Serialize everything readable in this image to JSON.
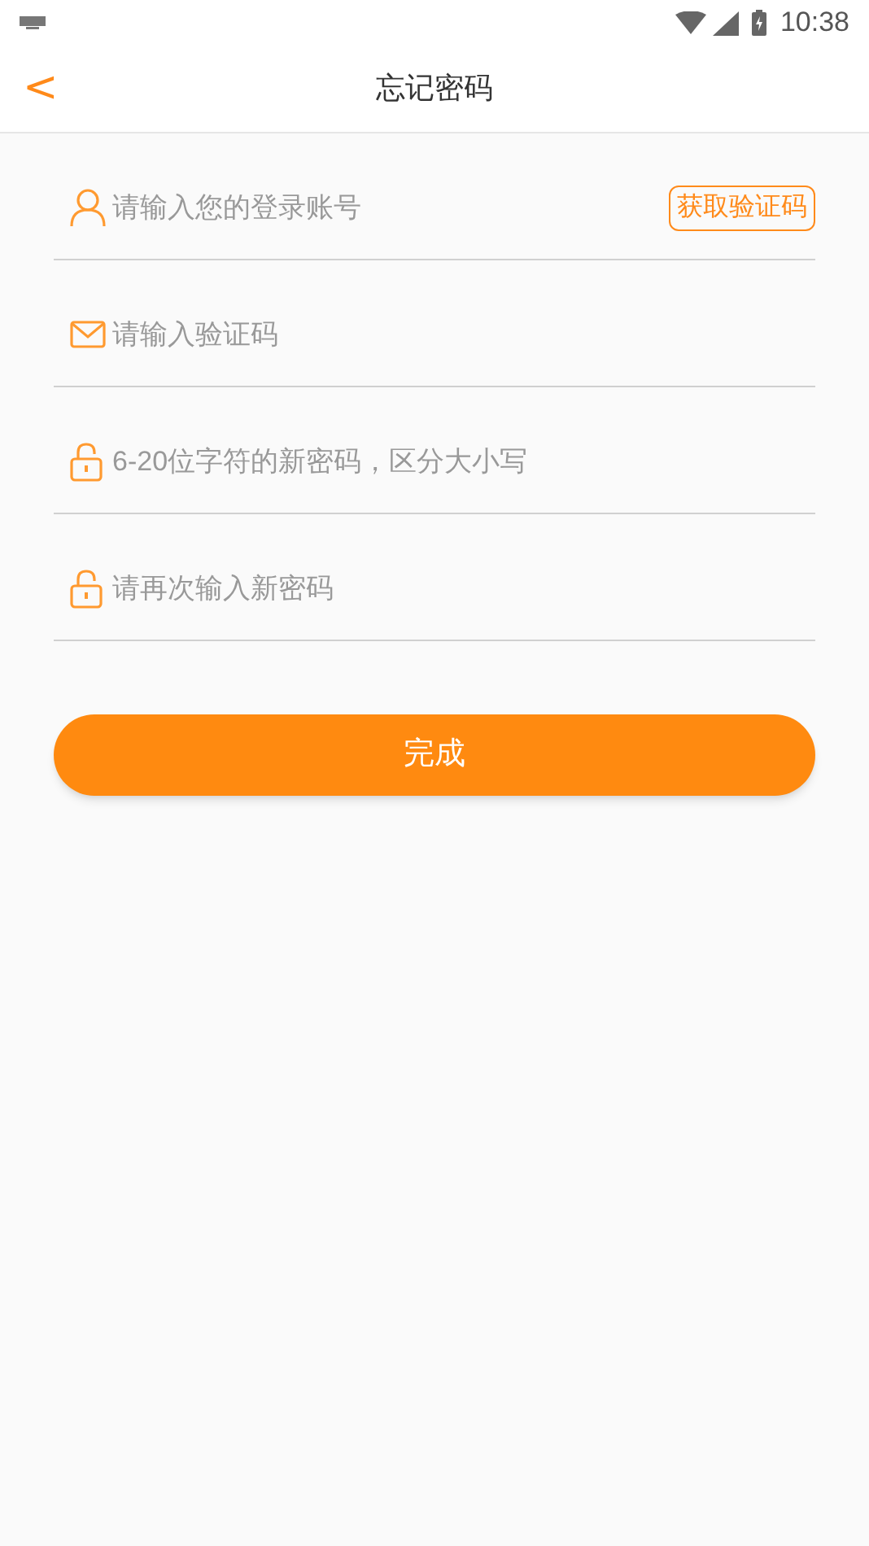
{
  "status_bar": {
    "time": "10:38"
  },
  "header": {
    "back": "<",
    "title": "忘记密码"
  },
  "fields": [
    {
      "kind": "user",
      "placeholder": "请输入您的登录账号",
      "action": "获取验证码"
    },
    {
      "kind": "mail",
      "placeholder": "请输入验证码"
    },
    {
      "kind": "lock",
      "placeholder": "6-20位字符的新密码，区分大小写"
    },
    {
      "kind": "lock",
      "placeholder": "请再次输入新密码"
    }
  ],
  "submit": "完成"
}
